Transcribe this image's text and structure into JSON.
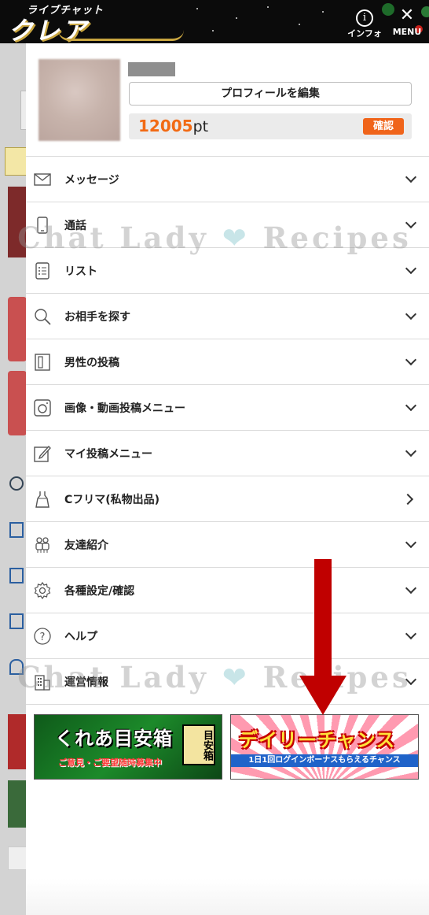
{
  "header": {
    "logo_small": "ライブチャット",
    "logo_big": "クレア",
    "info_label": "インフォ",
    "menu_label": "MENU"
  },
  "profile": {
    "edit_label": "プロフィールを編集",
    "points_value": "12005",
    "points_unit": "pt",
    "confirm_label": "確認"
  },
  "menu": {
    "items": [
      {
        "label": "メッセージ",
        "icon": "envelope-icon",
        "chevron": "down"
      },
      {
        "label": "通話",
        "icon": "phone-icon",
        "chevron": "down"
      },
      {
        "label": "リスト",
        "icon": "list-icon",
        "chevron": "down"
      },
      {
        "label": "お相手を探す",
        "icon": "search-icon",
        "chevron": "down"
      },
      {
        "label": "男性の投稿",
        "icon": "notebook-icon",
        "chevron": "down"
      },
      {
        "label": "画像・動画投稿メニュー",
        "icon": "camera-icon",
        "chevron": "down"
      },
      {
        "label": "マイ投稿メニュー",
        "icon": "pencil-icon",
        "chevron": "down"
      },
      {
        "label": "Cフリマ(私物出品)",
        "icon": "dress-icon",
        "chevron": "right"
      },
      {
        "label": "友達紹介",
        "icon": "friends-icon",
        "chevron": "down"
      },
      {
        "label": "各種設定/確認",
        "icon": "gear-icon",
        "chevron": "down"
      },
      {
        "label": "ヘルプ",
        "icon": "help-icon",
        "chevron": "down"
      },
      {
        "label": "運営情報",
        "icon": "building-icon",
        "chevron": "down"
      }
    ]
  },
  "banners": {
    "left_title": "くれあ目安箱",
    "left_sub": "ご意見・ご要望随時募集中",
    "left_box": "目安箱",
    "right_title": "デイリーチャンス",
    "right_sub": "1日1回ログインボーナスもらえるチャンス"
  },
  "watermark": {
    "text_left": "Chat Lady",
    "text_right": "Recipes"
  },
  "colors": {
    "accent_orange": "#f0641a",
    "points_orange": "#f26a14",
    "arrow_red": "#c00000"
  }
}
